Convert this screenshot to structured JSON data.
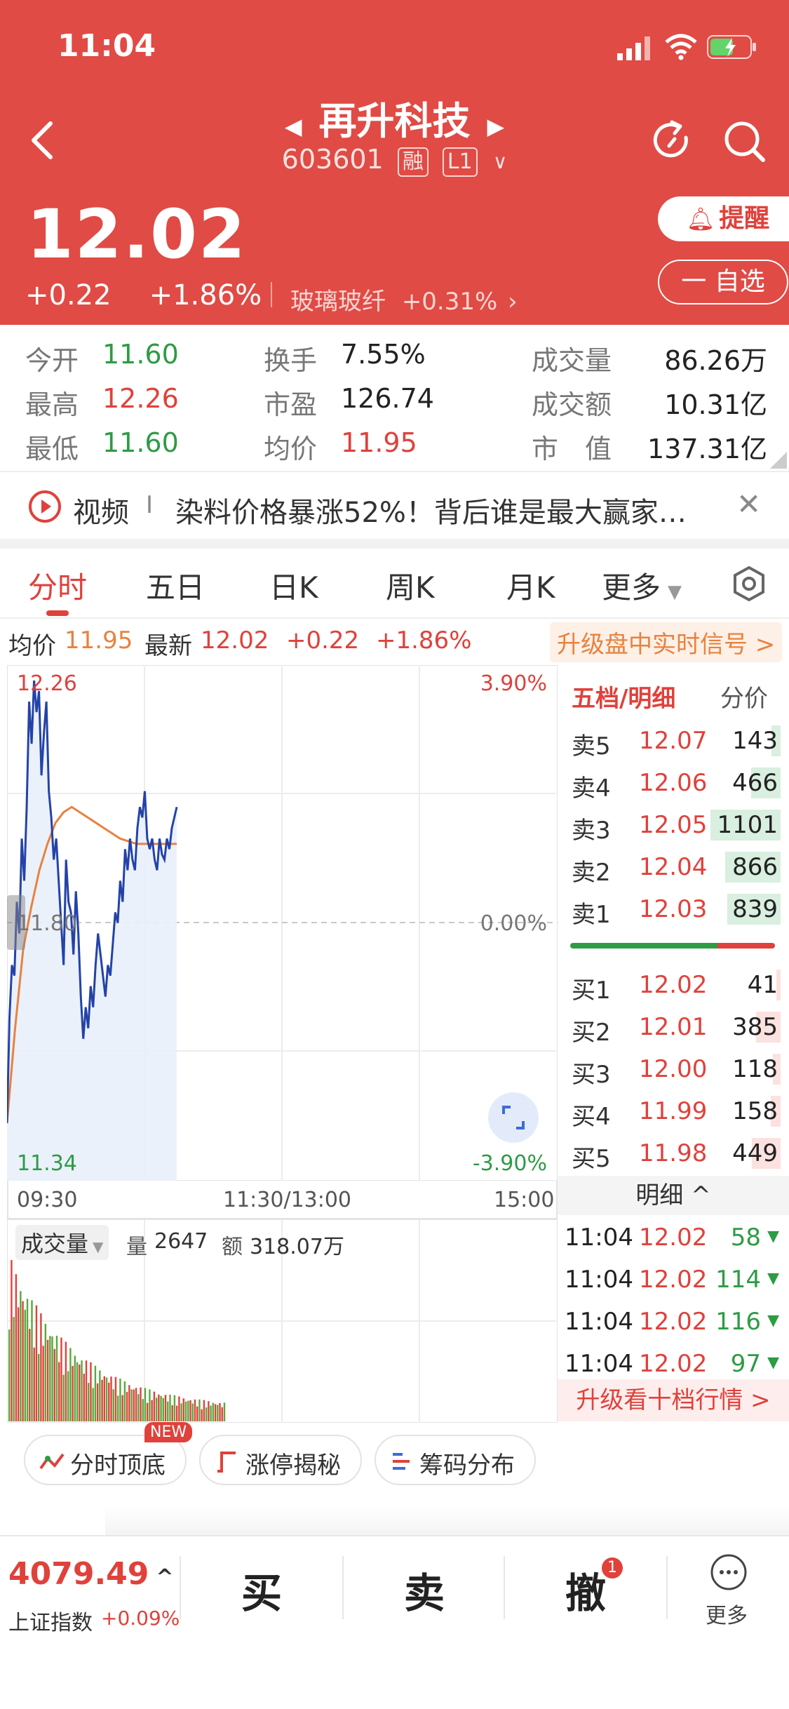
{
  "status_bar": {
    "time": "11:04"
  },
  "header": {
    "stock_name": "再升科技",
    "stock_code": "603601",
    "badge_margin": "融",
    "badge_level": "L1",
    "price": "12.02",
    "change": "+0.22",
    "change_pct": "+1.86%",
    "sector_name": "玻璃玻纤",
    "sector_change": "+0.31%",
    "alert_label": "提醒",
    "watchlist_label": "一 自选"
  },
  "stats": [
    {
      "label": "今开",
      "value": "11.60",
      "color": "green"
    },
    {
      "label": "换手",
      "value": "7.55%",
      "color": "neutral"
    },
    {
      "label": "成交量",
      "value": "86.26万",
      "color": "neutral"
    },
    {
      "label": "最高",
      "value": "12.26",
      "color": "red"
    },
    {
      "label": "市盈",
      "value": "126.74",
      "color": "neutral"
    },
    {
      "label": "成交额",
      "value": "10.31亿",
      "color": "neutral"
    },
    {
      "label": "最低",
      "value": "11.60",
      "color": "green"
    },
    {
      "label": "均价",
      "value": "11.95",
      "color": "red"
    },
    {
      "label": "市　值",
      "value": "137.31亿",
      "color": "neutral"
    }
  ],
  "news": {
    "label": "视频",
    "separator": "I",
    "text": "染料价格暴涨52%！背后谁是最大赢家…"
  },
  "tabs": [
    "分时",
    "五日",
    "日K",
    "周K",
    "月K",
    "更多"
  ],
  "info_bar": {
    "avg_label": "均价",
    "avg_value": "11.95",
    "latest_label": "最新",
    "latest_value": "12.02",
    "change": "+0.22",
    "change_pct": "+1.86%",
    "upgrade_link": "升级盘中实时信号 >"
  },
  "intraday": {
    "price_high_label": "12.26",
    "price_mid_label": "11.80",
    "price_low_label": "11.34",
    "pct_high_label": "3.90%",
    "pct_mid_label": "0.00%",
    "pct_low_label": "-3.90%",
    "time_labels": [
      "09:30",
      "11:30/13:00",
      "15:00"
    ]
  },
  "chart_data": {
    "type": "line",
    "ylim": [
      11.34,
      12.26
    ],
    "x_range_minutes": [
      0,
      240
    ],
    "series": [
      {
        "values": [
          11.42,
          11.62,
          11.72,
          11.7,
          11.84,
          11.78,
          11.96,
          11.88,
          12.02,
          12.22,
          12.14,
          12.26,
          12.2,
          12.24,
          12.08,
          12.16,
          12.22,
          12.05,
          12.0,
          11.92,
          11.96,
          11.88,
          11.8,
          11.72,
          11.92,
          11.84,
          11.82,
          11.74,
          11.86,
          11.78,
          11.66,
          11.58,
          11.64,
          11.6,
          11.68,
          11.64,
          11.72,
          11.78,
          11.74,
          11.7,
          11.66,
          11.72,
          11.7,
          11.76,
          11.82,
          11.8,
          11.88,
          11.84,
          11.94,
          11.9,
          11.96,
          11.92,
          11.9,
          11.98,
          12.02,
          12.0,
          12.05,
          11.96,
          11.94,
          11.96,
          11.92,
          11.9,
          11.96,
          11.93,
          11.92,
          11.96,
          11.94,
          11.98,
          12.0,
          12.02
        ]
      },
      {
        "values": [
          11.42,
          11.6,
          11.75,
          11.83,
          11.9,
          11.95,
          11.99,
          12.01,
          12.02,
          12.01,
          12.0,
          11.99,
          11.98,
          11.97,
          11.96,
          11.955,
          11.95,
          11.95,
          11.95,
          11.95,
          11.95,
          11.95
        ]
      }
    ]
  },
  "order_book": {
    "header_title": "五档/明细",
    "header_tab": "分价",
    "asks": [
      {
        "label": "卖5",
        "price": "12.07",
        "volume": "143",
        "bar": 0.13
      },
      {
        "label": "卖4",
        "price": "12.06",
        "volume": "466",
        "bar": 0.42
      },
      {
        "label": "卖3",
        "price": "12.05",
        "volume": "1101",
        "bar": 1.0
      },
      {
        "label": "卖2",
        "price": "12.04",
        "volume": "866",
        "bar": 0.79
      },
      {
        "label": "卖1",
        "price": "12.03",
        "volume": "839",
        "bar": 0.76
      }
    ],
    "bids": [
      {
        "label": "买1",
        "price": "12.02",
        "volume": "41",
        "bar": 0.04
      },
      {
        "label": "买2",
        "price": "12.01",
        "volume": "385",
        "bar": 0.35
      },
      {
        "label": "买3",
        "price": "12.00",
        "volume": "118",
        "bar": 0.11
      },
      {
        "label": "买4",
        "price": "11.99",
        "volume": "158",
        "bar": 0.14
      },
      {
        "label": "买5",
        "price": "11.98",
        "volume": "449",
        "bar": 0.41
      }
    ],
    "detail_label": "明细 ^",
    "trades": [
      {
        "time": "11:04",
        "price": "12.02",
        "volume": "58"
      },
      {
        "time": "11:04",
        "price": "12.02",
        "volume": "114"
      },
      {
        "time": "11:04",
        "price": "12.02",
        "volume": "116"
      },
      {
        "time": "11:04",
        "price": "12.02",
        "volume": "97"
      }
    ],
    "upgrade_label": "升级看十档行情 >"
  },
  "volume_panel": {
    "selector_label": "成交量",
    "qty_label": "量",
    "qty_value": "2647",
    "amount_label": "额",
    "amount_value": "318.07万"
  },
  "chips": [
    {
      "label": "分时顶底",
      "badge": "NEW"
    },
    {
      "label": "涨停揭秘"
    },
    {
      "label": "筹码分布"
    }
  ],
  "bottom_bar": {
    "index_value": "4079.49",
    "index_name": "上证指数",
    "index_change": "+0.09%",
    "buy_label": "买",
    "sell_label": "卖",
    "cancel_label": "撤",
    "cancel_badge": "1",
    "more_label": "更多"
  },
  "colors": {
    "header_red": "#e04b45",
    "up_red": "#e0413b",
    "down_green": "#2e9b45",
    "price_line": "#2443a8",
    "avg_line": "#e8823f"
  }
}
